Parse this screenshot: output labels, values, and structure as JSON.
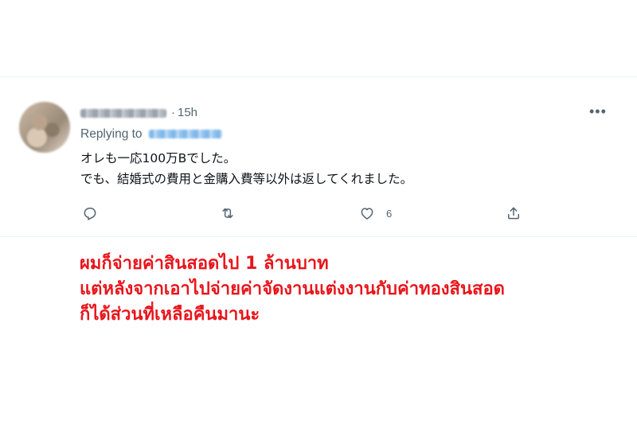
{
  "tweet": {
    "timestamp": "15h",
    "separator": "·",
    "more_icon": "more-icon",
    "replying_to_label": "Replying to",
    "lines": [
      "オレも一応100万Bでした。",
      "でも、結婚式の費用と金購入費等以外は返してくれました。"
    ],
    "actions": {
      "reply_icon": "reply-icon",
      "retweet_icon": "retweet-icon",
      "like_icon": "heart-icon",
      "like_count": "6",
      "share_icon": "share-icon"
    },
    "colors": {
      "text": "#0f1419",
      "secondary": "#536471",
      "link": "#1d9bf0"
    }
  },
  "caption": {
    "color": "#e8151b",
    "lines": [
      "ผมก็จ่ายค่าสินสอดไป 1 ล้านบาท",
      "แต่หลังจากเอาไปจ่ายค่าจัดงานแต่งงานกับค่าทองสินสอด",
      "ก็ได้ส่วนที่เหลือคืนมานะ"
    ]
  }
}
